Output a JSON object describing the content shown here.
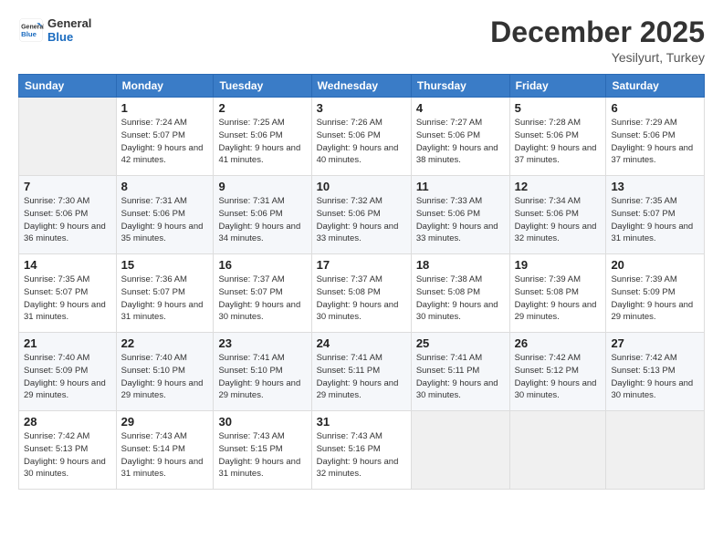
{
  "logo": {
    "line1": "General",
    "line2": "Blue"
  },
  "header": {
    "month": "December 2025",
    "location": "Yesilyurt, Turkey"
  },
  "days_of_week": [
    "Sunday",
    "Monday",
    "Tuesday",
    "Wednesday",
    "Thursday",
    "Friday",
    "Saturday"
  ],
  "weeks": [
    [
      {
        "day": "",
        "sunrise": "",
        "sunset": "",
        "daylight": ""
      },
      {
        "day": "1",
        "sunrise": "7:24 AM",
        "sunset": "5:07 PM",
        "daylight": "9 hours and 42 minutes."
      },
      {
        "day": "2",
        "sunrise": "7:25 AM",
        "sunset": "5:06 PM",
        "daylight": "9 hours and 41 minutes."
      },
      {
        "day": "3",
        "sunrise": "7:26 AM",
        "sunset": "5:06 PM",
        "daylight": "9 hours and 40 minutes."
      },
      {
        "day": "4",
        "sunrise": "7:27 AM",
        "sunset": "5:06 PM",
        "daylight": "9 hours and 38 minutes."
      },
      {
        "day": "5",
        "sunrise": "7:28 AM",
        "sunset": "5:06 PM",
        "daylight": "9 hours and 37 minutes."
      },
      {
        "day": "6",
        "sunrise": "7:29 AM",
        "sunset": "5:06 PM",
        "daylight": "9 hours and 37 minutes."
      }
    ],
    [
      {
        "day": "7",
        "sunrise": "7:30 AM",
        "sunset": "5:06 PM",
        "daylight": "9 hours and 36 minutes."
      },
      {
        "day": "8",
        "sunrise": "7:31 AM",
        "sunset": "5:06 PM",
        "daylight": "9 hours and 35 minutes."
      },
      {
        "day": "9",
        "sunrise": "7:31 AM",
        "sunset": "5:06 PM",
        "daylight": "9 hours and 34 minutes."
      },
      {
        "day": "10",
        "sunrise": "7:32 AM",
        "sunset": "5:06 PM",
        "daylight": "9 hours and 33 minutes."
      },
      {
        "day": "11",
        "sunrise": "7:33 AM",
        "sunset": "5:06 PM",
        "daylight": "9 hours and 33 minutes."
      },
      {
        "day": "12",
        "sunrise": "7:34 AM",
        "sunset": "5:06 PM",
        "daylight": "9 hours and 32 minutes."
      },
      {
        "day": "13",
        "sunrise": "7:35 AM",
        "sunset": "5:07 PM",
        "daylight": "9 hours and 31 minutes."
      }
    ],
    [
      {
        "day": "14",
        "sunrise": "7:35 AM",
        "sunset": "5:07 PM",
        "daylight": "9 hours and 31 minutes."
      },
      {
        "day": "15",
        "sunrise": "7:36 AM",
        "sunset": "5:07 PM",
        "daylight": "9 hours and 31 minutes."
      },
      {
        "day": "16",
        "sunrise": "7:37 AM",
        "sunset": "5:07 PM",
        "daylight": "9 hours and 30 minutes."
      },
      {
        "day": "17",
        "sunrise": "7:37 AM",
        "sunset": "5:08 PM",
        "daylight": "9 hours and 30 minutes."
      },
      {
        "day": "18",
        "sunrise": "7:38 AM",
        "sunset": "5:08 PM",
        "daylight": "9 hours and 30 minutes."
      },
      {
        "day": "19",
        "sunrise": "7:39 AM",
        "sunset": "5:08 PM",
        "daylight": "9 hours and 29 minutes."
      },
      {
        "day": "20",
        "sunrise": "7:39 AM",
        "sunset": "5:09 PM",
        "daylight": "9 hours and 29 minutes."
      }
    ],
    [
      {
        "day": "21",
        "sunrise": "7:40 AM",
        "sunset": "5:09 PM",
        "daylight": "9 hours and 29 minutes."
      },
      {
        "day": "22",
        "sunrise": "7:40 AM",
        "sunset": "5:10 PM",
        "daylight": "9 hours and 29 minutes."
      },
      {
        "day": "23",
        "sunrise": "7:41 AM",
        "sunset": "5:10 PM",
        "daylight": "9 hours and 29 minutes."
      },
      {
        "day": "24",
        "sunrise": "7:41 AM",
        "sunset": "5:11 PM",
        "daylight": "9 hours and 29 minutes."
      },
      {
        "day": "25",
        "sunrise": "7:41 AM",
        "sunset": "5:11 PM",
        "daylight": "9 hours and 30 minutes."
      },
      {
        "day": "26",
        "sunrise": "7:42 AM",
        "sunset": "5:12 PM",
        "daylight": "9 hours and 30 minutes."
      },
      {
        "day": "27",
        "sunrise": "7:42 AM",
        "sunset": "5:13 PM",
        "daylight": "9 hours and 30 minutes."
      }
    ],
    [
      {
        "day": "28",
        "sunrise": "7:42 AM",
        "sunset": "5:13 PM",
        "daylight": "9 hours and 30 minutes."
      },
      {
        "day": "29",
        "sunrise": "7:43 AM",
        "sunset": "5:14 PM",
        "daylight": "9 hours and 31 minutes."
      },
      {
        "day": "30",
        "sunrise": "7:43 AM",
        "sunset": "5:15 PM",
        "daylight": "9 hours and 31 minutes."
      },
      {
        "day": "31",
        "sunrise": "7:43 AM",
        "sunset": "5:16 PM",
        "daylight": "9 hours and 32 minutes."
      },
      {
        "day": "",
        "sunrise": "",
        "sunset": "",
        "daylight": ""
      },
      {
        "day": "",
        "sunrise": "",
        "sunset": "",
        "daylight": ""
      },
      {
        "day": "",
        "sunrise": "",
        "sunset": "",
        "daylight": ""
      }
    ]
  ]
}
